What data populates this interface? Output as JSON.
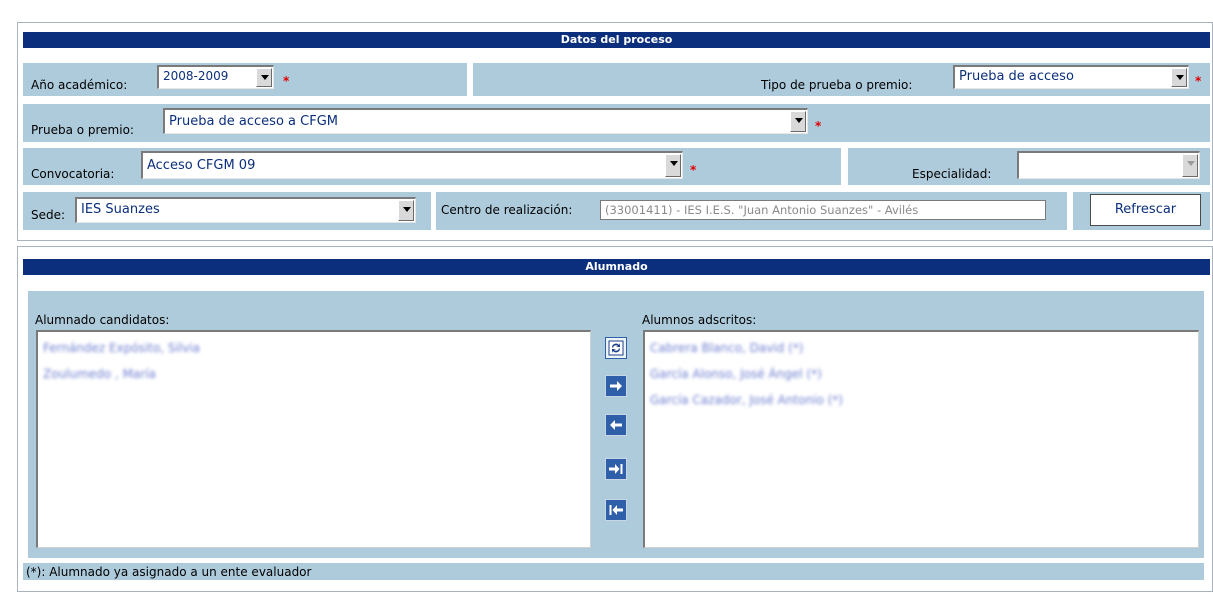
{
  "datos": {
    "header": "Datos del proceso",
    "anio_label": "Año académico:",
    "anio_value": "2008-2009",
    "tipo_label": "Tipo de prueba o premio:",
    "tipo_value": "Prueba de acceso",
    "prueba_label": "Prueba o premio:",
    "prueba_value": "Prueba de acceso a CFGM",
    "convocatoria_label": "Convocatoria:",
    "convocatoria_value": "Acceso CFGM 09",
    "especialidad_label": "Especialidad:",
    "especialidad_value": "",
    "sede_label": "Sede:",
    "sede_value": "IES Suanzes",
    "centro_label": "Centro de realización:",
    "centro_value": "(33001411) - IES I.E.S. \"Juan Antonio Suanzes\" - Avilés",
    "refrescar_label": "Refrescar",
    "required_mark": "*"
  },
  "alumnado": {
    "header": "Alumnado",
    "candidatos_label": "Alumnado candidatos:",
    "candidatos": [
      "Fernández Expósito, Silvia",
      "Zoulumedo , María"
    ],
    "adscritos_label": "Alumnos adscritos:",
    "adscritos": [
      "Cabrera Blanco, David (*)",
      "García Alonso, José Ángel (*)",
      "García Cazador, José Antonio (*)"
    ],
    "footnote": "(*): Alumnado ya asignado a un ente evaluador"
  },
  "icons": {
    "refresh": "refresh-icon",
    "move_right": "arrow-right-icon",
    "move_left": "arrow-left-icon",
    "move_all_right": "arrow-right-bar-icon",
    "move_all_left": "arrow-left-bar-icon"
  },
  "colors": {
    "header_bg": "#0b2f7d",
    "cell_bg": "#aecbdc",
    "required": "#e00000"
  }
}
